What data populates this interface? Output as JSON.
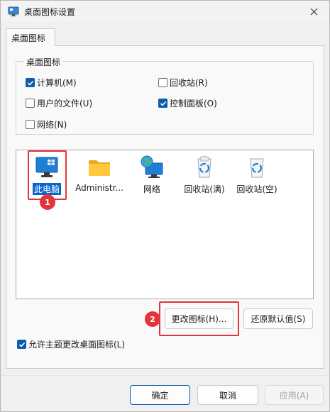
{
  "window": {
    "title": "桌面图标设置"
  },
  "tabs": [
    {
      "label": "桌面图标"
    }
  ],
  "desktop_icons_group": {
    "title": "桌面图标",
    "checkboxes": [
      {
        "label": "计算机(M)",
        "checked": true
      },
      {
        "label": "回收站(R)",
        "checked": false
      },
      {
        "label": "用户的文件(U)",
        "checked": false
      },
      {
        "label": "控制面板(O)",
        "checked": true
      },
      {
        "label": "网络(N)",
        "checked": false
      }
    ]
  },
  "icon_list": [
    {
      "label": "此电脑",
      "icon": "computer-icon",
      "selected": true
    },
    {
      "label": "Administr...",
      "icon": "folder-icon",
      "selected": false
    },
    {
      "label": "网络",
      "icon": "network-icon",
      "selected": false
    },
    {
      "label": "回收站(满)",
      "icon": "recycle-bin-full-icon",
      "selected": false
    },
    {
      "label": "回收站(空)",
      "icon": "recycle-bin-empty-icon",
      "selected": false
    }
  ],
  "annotations": [
    {
      "number": "1"
    },
    {
      "number": "2"
    }
  ],
  "buttons": {
    "change_icon": "更改图标(H)...",
    "restore_default": "还原默认值(S)",
    "ok": "确定",
    "cancel": "取消",
    "apply": "应用(A)"
  },
  "allow_themes": {
    "label": "允许主题更改桌面图标(L)",
    "checked": true
  },
  "colors": {
    "accent": "#0b5cad",
    "annotation": "#e3343c",
    "selection": "#0a64cc"
  }
}
